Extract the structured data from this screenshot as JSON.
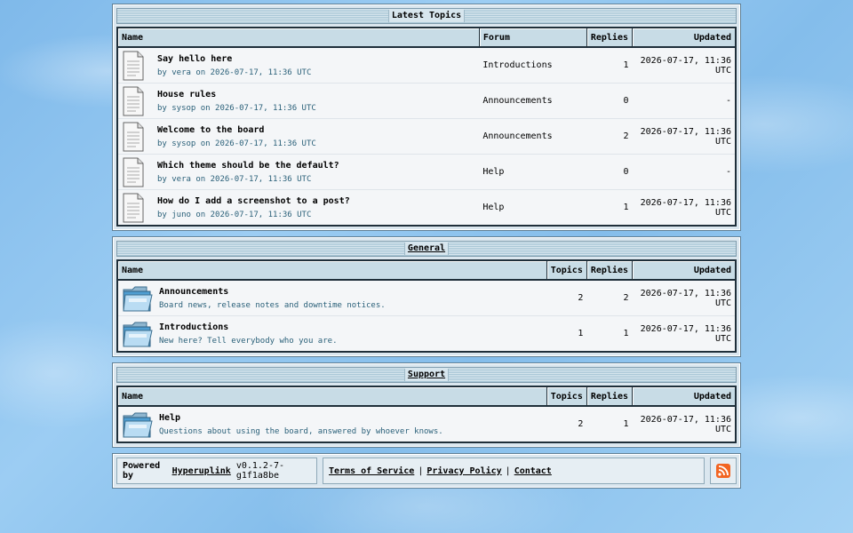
{
  "latest": {
    "title": "Latest Topics",
    "headers": {
      "name": "Name",
      "forum": "Forum",
      "replies": "Replies",
      "updated": "Updated"
    },
    "rows": [
      {
        "title": "Say hello here",
        "by": "by vera on 2026-07-17, 11:36 UTC",
        "forum": "Introductions",
        "replies": "1",
        "updated": "2026-07-17, 11:36 UTC"
      },
      {
        "title": "House rules",
        "by": "by sysop on 2026-07-17, 11:36 UTC",
        "forum": "Announcements",
        "replies": "0",
        "updated": "-"
      },
      {
        "title": "Welcome to the board",
        "by": "by sysop on 2026-07-17, 11:36 UTC",
        "forum": "Announcements",
        "replies": "2",
        "updated": "2026-07-17, 11:36 UTC"
      },
      {
        "title": "Which theme should be the default?",
        "by": "by vera on 2026-07-17, 11:36 UTC",
        "forum": "Help",
        "replies": "0",
        "updated": "-"
      },
      {
        "title": "How do I add a screenshot to a post?",
        "by": "by juno on 2026-07-17, 11:36 UTC",
        "forum": "Help",
        "replies": "1",
        "updated": "2026-07-17, 11:36 UTC"
      }
    ]
  },
  "general": {
    "title": "General",
    "headers": {
      "name": "Name",
      "topics": "Topics",
      "replies": "Replies",
      "updated": "Updated"
    },
    "rows": [
      {
        "title": "Announcements",
        "desc": "Board news, release notes and downtime notices.",
        "topics": "2",
        "replies": "2",
        "updated": "2026-07-17, 11:36 UTC"
      },
      {
        "title": "Introductions",
        "desc": "New here? Tell everybody who you are.",
        "topics": "1",
        "replies": "1",
        "updated": "2026-07-17, 11:36 UTC"
      }
    ]
  },
  "support": {
    "title": "Support",
    "headers": {
      "name": "Name",
      "topics": "Topics",
      "replies": "Replies",
      "updated": "Updated"
    },
    "rows": [
      {
        "title": "Help",
        "desc": "Questions about using the board, answered by whoever knows.",
        "topics": "2",
        "replies": "1",
        "updated": "2026-07-17, 11:36 UTC"
      }
    ]
  },
  "footer": {
    "powered_prefix": "Powered by",
    "powered_link": "Hyperuplink",
    "version": "v0.1.2-7-g1f1a8be",
    "links": [
      "Terms of Service",
      "Privacy Policy",
      "Contact"
    ],
    "separator": "|",
    "rss_icon": "rss-icon",
    "rss_color": "#f26522"
  }
}
